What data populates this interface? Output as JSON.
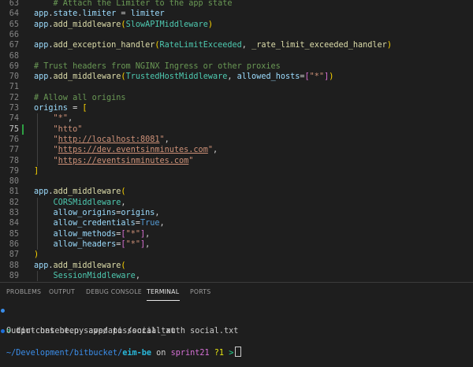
{
  "editor": {
    "active_line": 75,
    "modified_line": 75,
    "lines": [
      {
        "n": "63",
        "tokens": [
          [
            "c-com",
            "    # Attach the Limiter to the app state"
          ]
        ]
      },
      {
        "n": "64",
        "tokens": [
          [
            "c-var",
            "app"
          ],
          [
            "c-op",
            "."
          ],
          [
            "c-var",
            "state"
          ],
          [
            "c-op",
            "."
          ],
          [
            "c-var",
            "limiter"
          ],
          [
            "c-op",
            " = "
          ],
          [
            "c-var",
            "limiter"
          ]
        ]
      },
      {
        "n": "65",
        "tokens": [
          [
            "c-var",
            "app"
          ],
          [
            "c-op",
            "."
          ],
          [
            "c-fn",
            "add_middleware"
          ],
          [
            "c-br1",
            "("
          ],
          [
            "c-cls",
            "SlowAPIMiddleware"
          ],
          [
            "c-br1",
            ")"
          ]
        ]
      },
      {
        "n": "66",
        "tokens": []
      },
      {
        "n": "67",
        "tokens": [
          [
            "c-var",
            "app"
          ],
          [
            "c-op",
            "."
          ],
          [
            "c-fn",
            "add_exception_handler"
          ],
          [
            "c-br1",
            "("
          ],
          [
            "c-cls",
            "RateLimitExceeded"
          ],
          [
            "c-op",
            ", "
          ],
          [
            "c-fn",
            "_rate_limit_exceeded_handler"
          ],
          [
            "c-br1",
            ")"
          ]
        ]
      },
      {
        "n": "68",
        "tokens": []
      },
      {
        "n": "69",
        "tokens": [
          [
            "c-com",
            "# Trust headers from NGINX Ingress or other proxies"
          ]
        ]
      },
      {
        "n": "70",
        "tokens": [
          [
            "c-var",
            "app"
          ],
          [
            "c-op",
            "."
          ],
          [
            "c-fn",
            "add_middleware"
          ],
          [
            "c-br1",
            "("
          ],
          [
            "c-cls",
            "TrustedHostMiddleware"
          ],
          [
            "c-op",
            ", "
          ],
          [
            "c-var",
            "allowed_hosts"
          ],
          [
            "c-op",
            "="
          ],
          [
            "c-br2",
            "["
          ],
          [
            "c-str",
            "\"*\""
          ],
          [
            "c-br2",
            "]"
          ],
          [
            "c-br1",
            ")"
          ]
        ]
      },
      {
        "n": "71",
        "tokens": []
      },
      {
        "n": "72",
        "tokens": [
          [
            "c-com",
            "# Allow all origins"
          ]
        ]
      },
      {
        "n": "73",
        "tokens": [
          [
            "c-var",
            "origins"
          ],
          [
            "c-op",
            " = "
          ],
          [
            "c-br1",
            "["
          ]
        ]
      },
      {
        "n": "74",
        "tokens": [
          [
            "c-op",
            "    "
          ],
          [
            "c-str",
            "\"*\""
          ],
          [
            "c-op",
            ","
          ]
        ]
      },
      {
        "n": "75",
        "tokens": [
          [
            "c-op",
            "    "
          ],
          [
            "c-str",
            "\"htto\""
          ]
        ]
      },
      {
        "n": "76",
        "tokens": [
          [
            "c-op",
            "    "
          ],
          [
            "c-str",
            "\""
          ],
          [
            "c-str c-url",
            "http://localhost:8081"
          ],
          [
            "c-str",
            "\""
          ],
          [
            "c-op",
            ","
          ]
        ]
      },
      {
        "n": "77",
        "tokens": [
          [
            "c-op",
            "    "
          ],
          [
            "c-str",
            "\""
          ],
          [
            "c-str c-url",
            "https://dev.eventsinminutes.com"
          ],
          [
            "c-str",
            "\""
          ],
          [
            "c-op",
            ","
          ]
        ]
      },
      {
        "n": "78",
        "tokens": [
          [
            "c-op",
            "    "
          ],
          [
            "c-str",
            "\""
          ],
          [
            "c-str c-url",
            "https://eventsinminutes.com"
          ],
          [
            "c-str",
            "\""
          ]
        ]
      },
      {
        "n": "79",
        "tokens": [
          [
            "c-br1",
            "]"
          ]
        ]
      },
      {
        "n": "80",
        "tokens": []
      },
      {
        "n": "81",
        "tokens": [
          [
            "c-var",
            "app"
          ],
          [
            "c-op",
            "."
          ],
          [
            "c-fn",
            "add_middleware"
          ],
          [
            "c-br1",
            "("
          ]
        ]
      },
      {
        "n": "82",
        "tokens": [
          [
            "c-op",
            "    "
          ],
          [
            "c-cls",
            "CORSMiddleware"
          ],
          [
            "c-op",
            ","
          ]
        ]
      },
      {
        "n": "83",
        "tokens": [
          [
            "c-op",
            "    "
          ],
          [
            "c-var",
            "allow_origins"
          ],
          [
            "c-op",
            "="
          ],
          [
            "c-var",
            "origins"
          ],
          [
            "c-op",
            ","
          ]
        ]
      },
      {
        "n": "84",
        "tokens": [
          [
            "c-op",
            "    "
          ],
          [
            "c-var",
            "allow_credentials"
          ],
          [
            "c-op",
            "="
          ],
          [
            "c-kw",
            "True"
          ],
          [
            "c-op",
            ","
          ]
        ]
      },
      {
        "n": "85",
        "tokens": [
          [
            "c-op",
            "    "
          ],
          [
            "c-var",
            "allow_methods"
          ],
          [
            "c-op",
            "="
          ],
          [
            "c-br2",
            "["
          ],
          [
            "c-str",
            "\"*\""
          ],
          [
            "c-br2",
            "]"
          ],
          [
            "c-op",
            ","
          ]
        ]
      },
      {
        "n": "86",
        "tokens": [
          [
            "c-op",
            "    "
          ],
          [
            "c-var",
            "allow_headers"
          ],
          [
            "c-op",
            "="
          ],
          [
            "c-br2",
            "["
          ],
          [
            "c-str",
            "\"*\""
          ],
          [
            "c-br2",
            "]"
          ],
          [
            "c-op",
            ","
          ]
        ]
      },
      {
        "n": "87",
        "tokens": [
          [
            "c-br1",
            ")"
          ]
        ]
      },
      {
        "n": "88",
        "tokens": [
          [
            "c-var",
            "app"
          ],
          [
            "c-op",
            "."
          ],
          [
            "c-fn",
            "add_middleware"
          ],
          [
            "c-br1",
            "("
          ]
        ]
      },
      {
        "n": "89",
        "tokens": [
          [
            "c-op",
            "    "
          ],
          [
            "c-cls",
            "SessionMiddleware"
          ],
          [
            "c-op",
            ","
          ]
        ]
      }
    ]
  },
  "panel": {
    "tabs": [
      {
        "label": "PROBLEMS",
        "active": false
      },
      {
        "label": "OUTPUT",
        "active": false
      },
      {
        "label": "DEBUG CONSOLE",
        "active": false
      },
      {
        "label": "TERMINAL",
        "active": true
      },
      {
        "label": "PORTS",
        "active": false
      }
    ],
    "terminal": {
      "command_prompt": "> ",
      "command": "dir-content.py app/apis/social_auth social.txt",
      "output": "Output has been saved to social.txt",
      "path": "~/Development/bitbucket/",
      "repo": "eim-be",
      "on_word": " on ",
      "branch": "sprint21",
      "status": "?1",
      "prompt_symbol": ">",
      "dot1_color": "#3b8eea",
      "dot2_color": "#1e6fd9"
    }
  }
}
